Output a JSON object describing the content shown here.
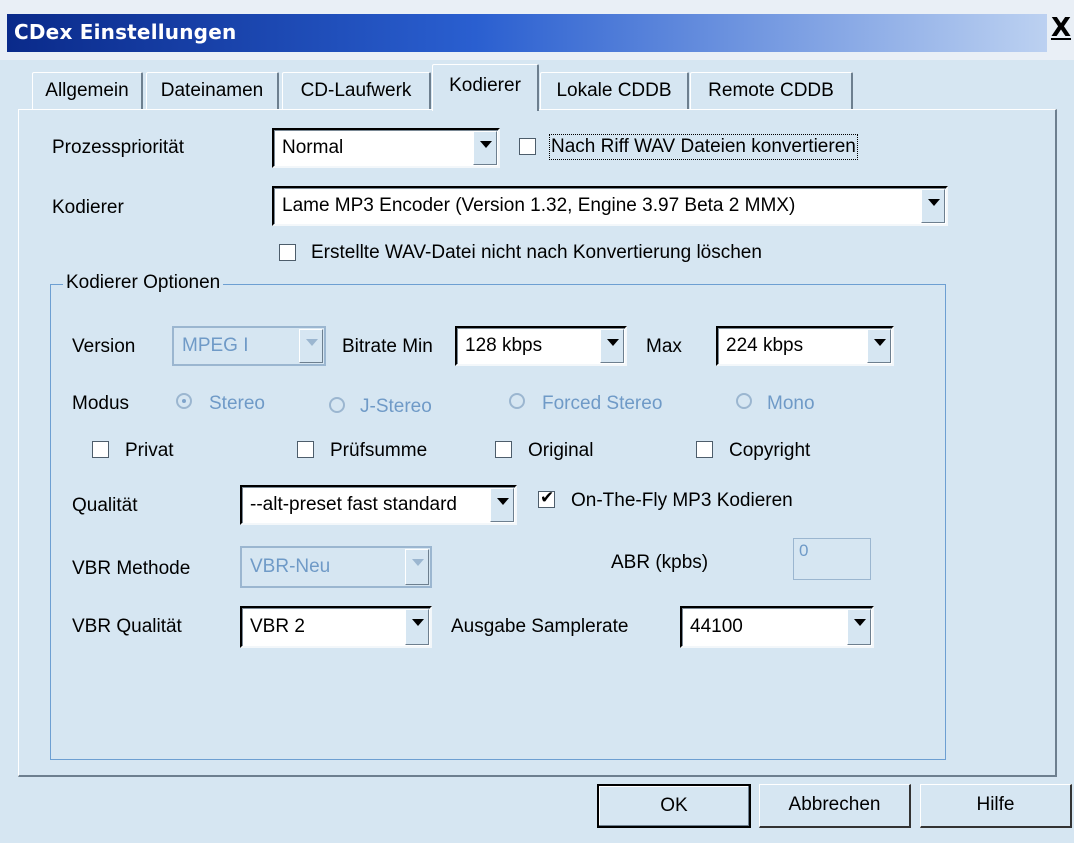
{
  "window": {
    "title": "CDex Einstellungen",
    "close_label": "X"
  },
  "tabs": [
    {
      "label": "Allgemein"
    },
    {
      "label": "Dateinamen"
    },
    {
      "label": "CD-Laufwerk"
    },
    {
      "label": "Kodierer",
      "active": true
    },
    {
      "label": "Lokale CDDB"
    },
    {
      "label": "Remote CDDB"
    }
  ],
  "general": {
    "priority_label": "Prozesspriorität",
    "priority_value": "Normal",
    "riff_checkbox_label": "Nach Riff WAV Dateien konvertieren",
    "riff_checked": false,
    "encoder_label": "Kodierer",
    "encoder_value": "Lame MP3 Encoder (Version 1.32, Engine 3.97 Beta 2 MMX)",
    "keep_wav_label": "Erstellte WAV-Datei nicht nach Konvertierung löschen",
    "keep_wav_checked": false
  },
  "options": {
    "group_title": "Kodierer Optionen",
    "version_label": "Version",
    "version_value": "MPEG I",
    "bitrate_min_label": "Bitrate Min",
    "bitrate_min_value": "128 kbps",
    "max_label": "Max",
    "max_value": "224 kbps",
    "mode_label": "Modus",
    "modes": [
      {
        "label": "Stereo",
        "selected": true
      },
      {
        "label": "J-Stereo",
        "selected": false
      },
      {
        "label": "Forced Stereo",
        "selected": false
      },
      {
        "label": "Mono",
        "selected": false
      }
    ],
    "flags": [
      {
        "label": "Privat",
        "checked": false
      },
      {
        "label": "Prüfsumme",
        "checked": false
      },
      {
        "label": "Original",
        "checked": false
      },
      {
        "label": "Copyright",
        "checked": false
      }
    ],
    "quality_label": "Qualität",
    "quality_value": "--alt-preset fast standard",
    "onthefly_label": "On-The-Fly MP3 Kodieren",
    "onthefly_checked": true,
    "vbr_method_label": "VBR Methode",
    "vbr_method_value": "VBR-Neu",
    "abr_label": "ABR (kpbs)",
    "abr_value": "0",
    "vbr_quality_label": "VBR Qualität",
    "vbr_quality_value": "VBR 2",
    "samplerate_label": "Ausgabe Samplerate",
    "samplerate_value": "44100"
  },
  "buttons": {
    "ok": "OK",
    "cancel": "Abbrechen",
    "help": "Hilfe"
  },
  "colors": {
    "face": "#d6e6f2",
    "disabled_text": "#6f9ac7",
    "title_start": "#0a2a8a"
  }
}
